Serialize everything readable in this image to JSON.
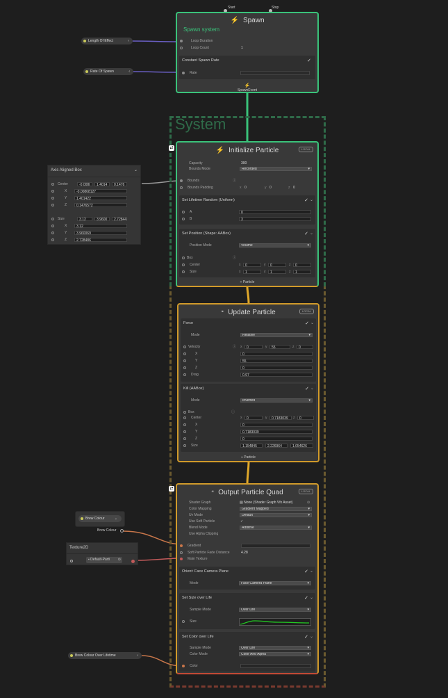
{
  "spawn": {
    "top_port_start": "Start",
    "top_port_stop": "Stop",
    "title": "Spawn",
    "subtitle": "Spawn system",
    "loop_duration_label": "Loop Duration",
    "loop_count_label": "Loop Count",
    "loop_count_value": "1",
    "rate_block_title": "Constant Spawn Rate",
    "rate_label": "Rate",
    "footer": "SpawnEvent"
  },
  "inputs": {
    "length_of_effect": "Length Of Effect",
    "rate_of_spawn": "Rate Of Spawn",
    "brew_colour": "Brew Colour",
    "brew_colour_out": "Brew Colour",
    "texture_title": "Texture2D",
    "texture_value": "Default-Parti",
    "brew_colour_lifetime": "Brew Colour Over Lifetime"
  },
  "system_label": "System",
  "aabox": {
    "title": "Axis Aligned Box",
    "center_label": "Center",
    "center_xyz": [
      "-0.008t",
      "1.4014",
      "0.1476"
    ],
    "cx": "-0.00868127",
    "cy": "1.401422",
    "cz": "0.1476572",
    "size_label": "Size",
    "size_xyz": [
      "3.12",
      "3.9600",
      "2.72844"
    ],
    "sx": "3.12",
    "sy": "3.960069",
    "sz": "2.728486",
    "x": "X",
    "y": "Y",
    "z": "Z"
  },
  "init": {
    "title": "Initialize Particle",
    "local": "LOCAL",
    "capacity_label": "Capacity",
    "capacity_value": "300",
    "bounds_mode_label": "Bounds Mode",
    "bounds_mode_value": "Recorded",
    "bounds_label": "Bounds",
    "bounds_padding_label": "Bounds Padding",
    "bp": [
      "0",
      "0",
      "0"
    ],
    "lifetime_title": "Set Lifetime Random (Uniform)",
    "a_label": "A",
    "a_value": "0",
    "b_label": "B",
    "b_value": "3",
    "position_title": "Set Position (Shape: AABox)",
    "position_mode_label": "Position Mode",
    "position_mode_value": "Volume",
    "box_label": "Box",
    "center_label": "Center",
    "center_xyz": [
      "0",
      "0",
      "0"
    ],
    "size_label": "Size",
    "size_xyz": [
      "1",
      "1",
      "1"
    ],
    "footer": "Particle"
  },
  "update": {
    "title": "Update Particle",
    "local": "LOCAL",
    "force_title": "Force",
    "mode_label": "Mode",
    "mode_value": "Relative",
    "velocity_label": "Velocity",
    "velocity_xyz": [
      "0",
      "55",
      "0"
    ],
    "vx": "0",
    "vy": "55",
    "vz": "0",
    "drag_label": "Drag",
    "drag_value": "0.97",
    "kill_title": "Kill (AABox)",
    "kill_mode_label": "Mode",
    "kill_mode_value": "Inverted",
    "box_label": "Box",
    "center_label": "Center",
    "center_xyz": [
      "0",
      "0.7183039",
      "0"
    ],
    "cx": "0",
    "cy": "0.7183039",
    "cz": "0",
    "size_label": "Size",
    "size_xyz": [
      "1.154845",
      "2.226964",
      "1.054626"
    ],
    "footer": "Particle",
    "x": "X",
    "y": "Y",
    "z": "Z"
  },
  "output": {
    "title": "Output Particle Quad",
    "local": "LOCAL",
    "shader_graph_label": "Shader Graph",
    "shader_graph_value": "None (Shader Graph Vfx Asset)",
    "color_mapping_label": "Color Mapping",
    "color_mapping_value": "Gradient Mapped",
    "uv_mode_label": "Uv Mode",
    "uv_mode_value": "Default",
    "use_soft_label": "Use Soft Particle",
    "use_soft_value": "✓",
    "blend_mode_label": "Blend Mode",
    "blend_mode_value": "Additive",
    "use_alpha_label": "Use Alpha Clipping",
    "gradient_label": "Gradient",
    "soft_fade_label": "Soft Particle Fade Distance",
    "soft_fade_value": "4.28",
    "main_texture_label": "Main Texture",
    "orient_title": "Orient: Face Camera Plane",
    "orient_mode_label": "Mode",
    "orient_mode_value": "Face Camera Plane",
    "size_title": "Set Size over Life",
    "sample_mode_label": "Sample Mode",
    "sample_mode_value": "Over Life",
    "size_label": "Size",
    "color_title": "Set Color over Life",
    "c_sample_mode_label": "Sample Mode",
    "c_sample_mode_value": "Over Life",
    "color_mode_label": "Color Mode",
    "color_mode_value": "Color And Alpha",
    "color_label": "Color"
  },
  "colors": {
    "spawn_green": "#3ac27a",
    "particle_orange": "#d19a2a",
    "output_red": "#c24a36",
    "size_curve": "#22cc22"
  }
}
